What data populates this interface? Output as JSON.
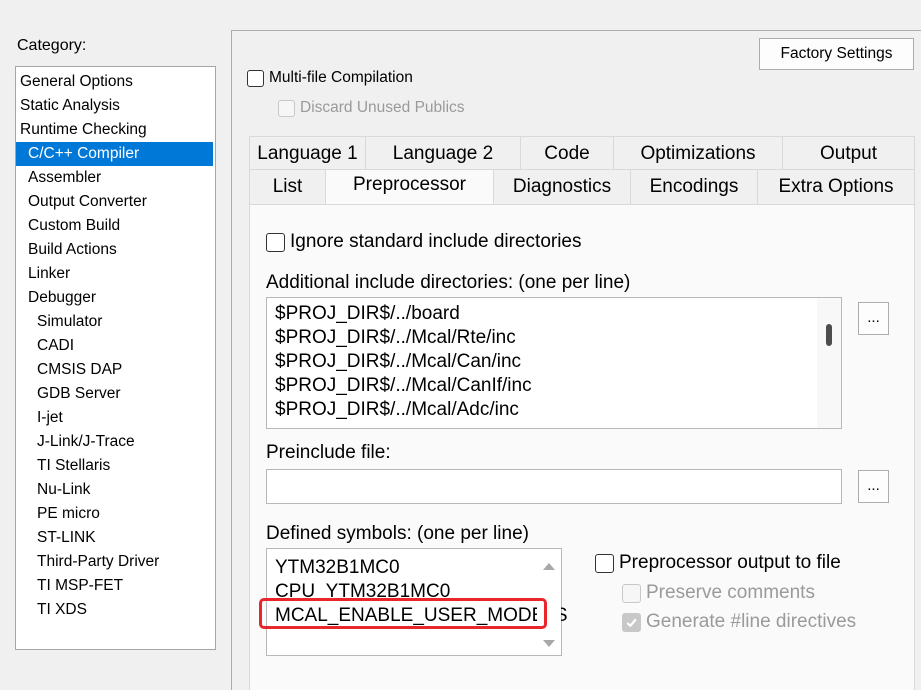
{
  "category": {
    "label": "Category:",
    "items": [
      {
        "label": "General Options",
        "level": 0,
        "selected": false
      },
      {
        "label": "Static Analysis",
        "level": 0,
        "selected": false
      },
      {
        "label": "Runtime Checking",
        "level": 0,
        "selected": false
      },
      {
        "label": "C/C++ Compiler",
        "level": 1,
        "selected": true
      },
      {
        "label": "Assembler",
        "level": 1,
        "selected": false
      },
      {
        "label": "Output Converter",
        "level": 1,
        "selected": false
      },
      {
        "label": "Custom Build",
        "level": 1,
        "selected": false
      },
      {
        "label": "Build Actions",
        "level": 1,
        "selected": false
      },
      {
        "label": "Linker",
        "level": 1,
        "selected": false
      },
      {
        "label": "Debugger",
        "level": 1,
        "selected": false
      },
      {
        "label": "Simulator",
        "level": 2,
        "selected": false
      },
      {
        "label": "CADI",
        "level": 2,
        "selected": false
      },
      {
        "label": "CMSIS DAP",
        "level": 2,
        "selected": false
      },
      {
        "label": "GDB Server",
        "level": 2,
        "selected": false
      },
      {
        "label": "I-jet",
        "level": 2,
        "selected": false
      },
      {
        "label": "J-Link/J-Trace",
        "level": 2,
        "selected": false
      },
      {
        "label": "TI Stellaris",
        "level": 2,
        "selected": false
      },
      {
        "label": "Nu-Link",
        "level": 2,
        "selected": false
      },
      {
        "label": "PE micro",
        "level": 2,
        "selected": false
      },
      {
        "label": "ST-LINK",
        "level": 2,
        "selected": false
      },
      {
        "label": "Third-Party Driver",
        "level": 2,
        "selected": false
      },
      {
        "label": "TI MSP-FET",
        "level": 2,
        "selected": false
      },
      {
        "label": "TI XDS",
        "level": 2,
        "selected": false
      }
    ]
  },
  "factory_settings_label": "Factory Settings",
  "multi_file": {
    "label": "Multi-file Compilation",
    "checked": false
  },
  "discard_unused": {
    "label": "Discard Unused Publics",
    "checked": false,
    "enabled": false
  },
  "tabs_row1": [
    "Language 1",
    "Language 2",
    "Code",
    "Optimizations",
    "Output"
  ],
  "tabs_row2": [
    "List",
    "Preprocessor",
    "Diagnostics",
    "Encodings",
    "Extra Options"
  ],
  "active_tab": "Preprocessor",
  "preprocessor": {
    "ignore_std": {
      "label": "Ignore standard include directories",
      "checked": false
    },
    "include_dirs_label": "Additional include directories: (one per line)",
    "include_dirs": [
      "$PROJ_DIR$/../board",
      "$PROJ_DIR$/../Mcal/Rte/inc",
      "$PROJ_DIR$/../Mcal/Can/inc",
      "$PROJ_DIR$/../Mcal/CanIf/inc",
      "$PROJ_DIR$/../Mcal/Adc/inc"
    ],
    "browse_label": "...",
    "preinclude_label": "Preinclude file:",
    "preinclude_value": "",
    "defined_symbols_label": "Defined symbols: (one per line)",
    "defined_symbols": [
      "YTM32B1MC0",
      "CPU_YTM32B1MC0",
      "MCAL_ENABLE_USER_MODE_S"
    ],
    "output_to_file": {
      "label": "Preprocessor output to file",
      "checked": false
    },
    "preserve_comments": {
      "label": "Preserve comments",
      "checked": false,
      "enabled": false
    },
    "generate_line": {
      "label": "Generate #line directives",
      "checked": true,
      "enabled": false
    }
  },
  "highlight_color": "#e8262b",
  "selection_color": "#0078d7"
}
